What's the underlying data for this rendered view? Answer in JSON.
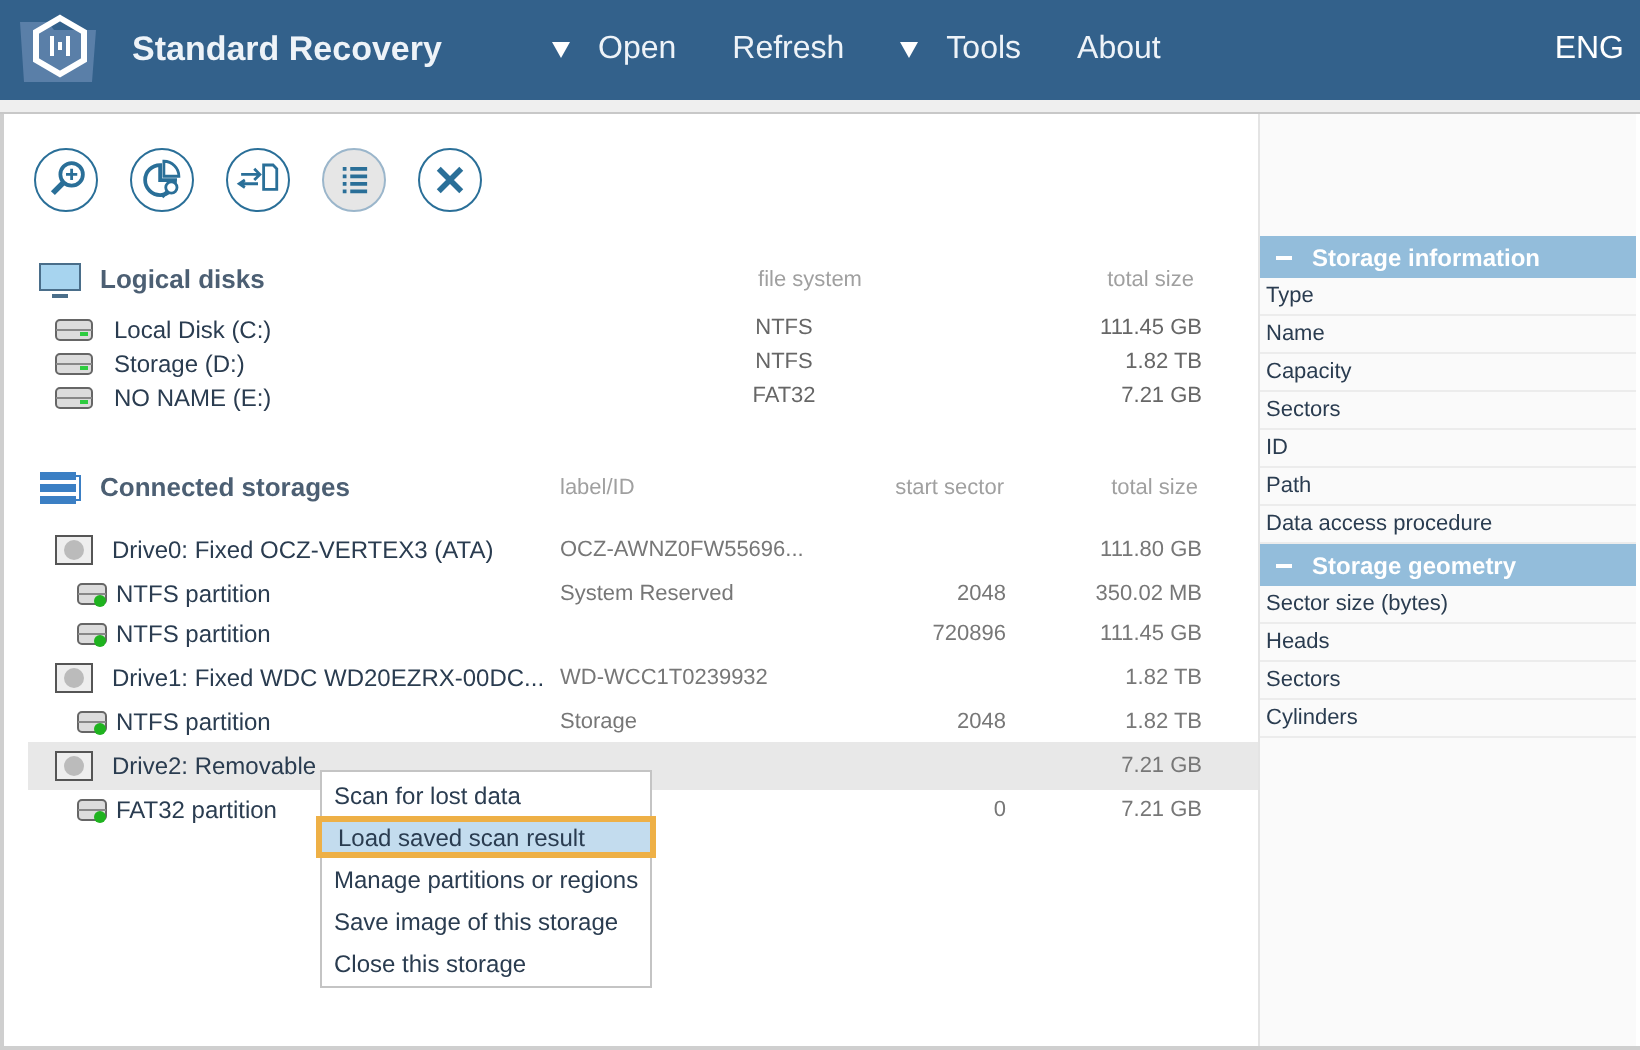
{
  "app": {
    "title": "Standard Recovery"
  },
  "menu": [
    {
      "label": "Open",
      "dropdown": true
    },
    {
      "label": "Refresh",
      "dropdown": false
    },
    {
      "label": "Tools",
      "dropdown": true
    },
    {
      "label": "About",
      "dropdown": false
    }
  ],
  "language": "ENG",
  "toolbar": [
    {
      "kind": "search",
      "selected": false
    },
    {
      "kind": "partition",
      "selected": false
    },
    {
      "kind": "transfer",
      "selected": false
    },
    {
      "kind": "list",
      "selected": true
    },
    {
      "kind": "close",
      "selected": false
    }
  ],
  "logical_disks": {
    "title": "Logical disks",
    "columns": [
      "file system",
      "total size"
    ],
    "rows": [
      {
        "name": "Local Disk (C:)",
        "file_system": "NTFS",
        "total_size": "111.45 GB"
      },
      {
        "name": "Storage (D:)",
        "file_system": "NTFS",
        "total_size": "1.82 TB"
      },
      {
        "name": "NO NAME (E:)",
        "file_system": "FAT32",
        "total_size": "7.21 GB"
      }
    ]
  },
  "connected_storages": {
    "title": "Connected storages",
    "columns": [
      "label/ID",
      "start sector",
      "total size"
    ],
    "drives": [
      {
        "name": "Drive0: Fixed OCZ-VERTEX3 (ATA)",
        "label": "OCZ-AWNZ0FW55696...",
        "total_size": "111.80 GB",
        "selected": false,
        "children": [
          {
            "name": "NTFS partition",
            "label": "System Reserved",
            "start_sector": "2048",
            "total_size": "350.02 MB"
          },
          {
            "name": "NTFS partition",
            "start_sector": "720896",
            "total_size": "111.45 GB"
          }
        ]
      },
      {
        "name": "Drive1: Fixed WDC WD20EZRX-00DC...",
        "label": "WD-WCC1T0239932",
        "total_size": "1.82 TB",
        "selected": false,
        "children": [
          {
            "name": "NTFS partition",
            "label": "Storage",
            "start_sector": "2048",
            "total_size": "1.82 TB"
          }
        ]
      },
      {
        "name": "Drive2: Removable",
        "total_size": "7.21 GB",
        "selected": true,
        "children": [
          {
            "name": "FAT32 partition",
            "start_sector": "0",
            "total_size": "7.21 GB"
          }
        ]
      }
    ]
  },
  "context_menu": [
    {
      "label": "Scan for lost data",
      "selected": false
    },
    {
      "label": "Load saved scan result",
      "selected": true
    },
    {
      "label": "Manage partitions or regions",
      "selected": false
    },
    {
      "label": "Save image of this storage",
      "selected": false
    },
    {
      "label": "Close this storage",
      "selected": false
    }
  ],
  "info_panel": [
    {
      "title": "Storage information",
      "expanded": true,
      "rows": [
        "Type",
        "Name",
        "Capacity",
        "Sectors",
        "ID",
        "Path",
        "Data access procedure"
      ]
    },
    {
      "title": "Storage geometry",
      "expanded": true,
      "rows": [
        "Sector size (bytes)",
        "Heads",
        "Sectors",
        "Cylinders"
      ]
    }
  ]
}
